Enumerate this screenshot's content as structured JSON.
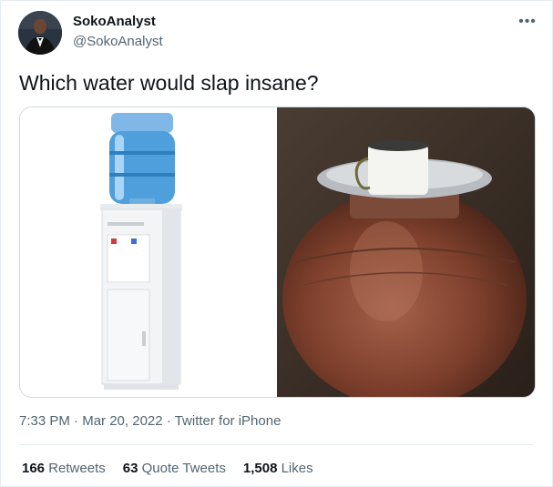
{
  "author": {
    "name": "SokoAnalyst",
    "handle": "@SokoAnalyst"
  },
  "more_icon": "more-horizontal-icon",
  "tweet": {
    "text": "Which water would slap insane?"
  },
  "media": {
    "left_image": "water-dispenser-image",
    "right_image": "clay-pot-image"
  },
  "meta": {
    "time": "7:33 PM",
    "separator": "·",
    "date": "Mar 20, 2022",
    "source": "Twitter for iPhone"
  },
  "stats": {
    "retweets": {
      "count": "166",
      "label": "Retweets"
    },
    "quotes": {
      "count": "63",
      "label": "Quote Tweets"
    },
    "likes": {
      "count": "1,508",
      "label": "Likes"
    }
  }
}
